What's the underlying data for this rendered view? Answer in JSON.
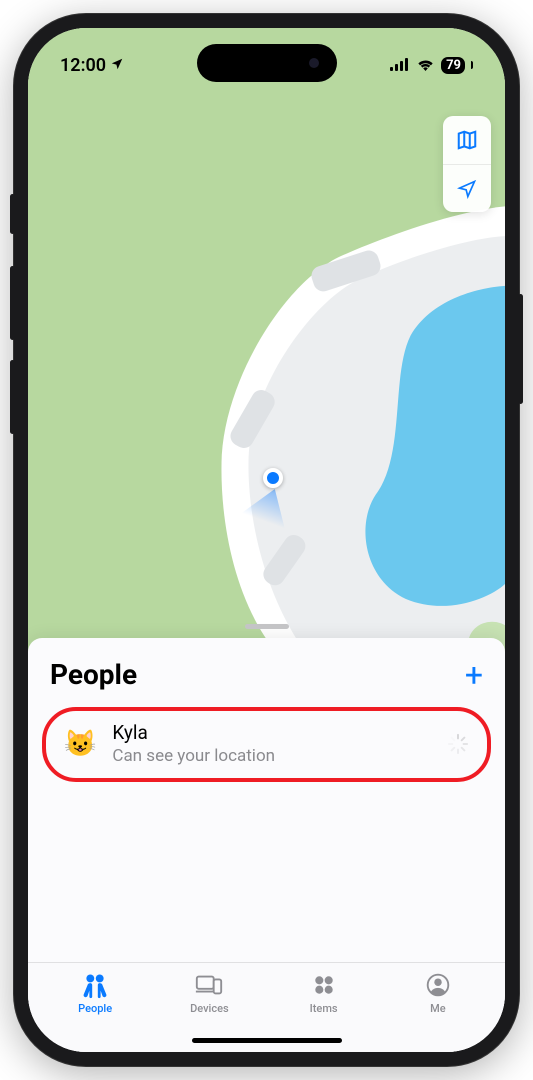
{
  "status": {
    "time": "12:00",
    "battery": "79"
  },
  "sheet": {
    "title": "People",
    "add_symbol": "+"
  },
  "person": {
    "avatar_emoji": "😺",
    "name": "Kyla",
    "subtitle": "Can see your location"
  },
  "tabs": {
    "people": "People",
    "devices": "Devices",
    "items": "Items",
    "me": "Me"
  }
}
